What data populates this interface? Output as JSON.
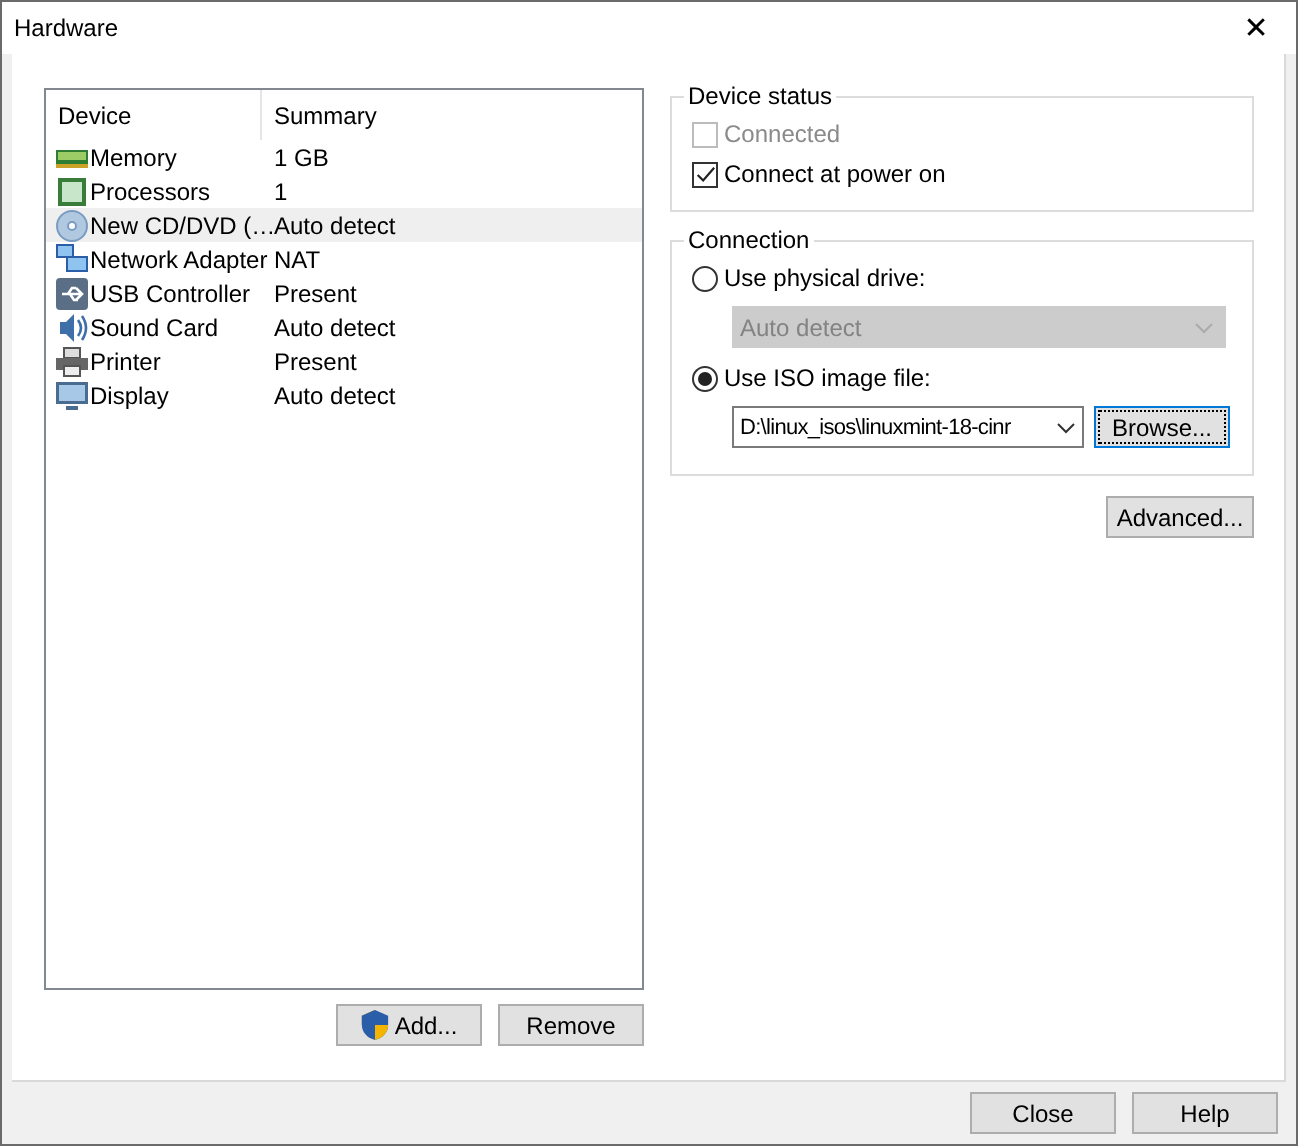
{
  "window": {
    "title": "Hardware",
    "close": "✕"
  },
  "device_list": {
    "columns": [
      "Device",
      "Summary"
    ],
    "rows": [
      {
        "kind": "memory",
        "device": "Memory",
        "summary": "1 GB",
        "selected": false
      },
      {
        "kind": "processor",
        "device": "Processors",
        "summary": "1",
        "selected": false
      },
      {
        "kind": "disc",
        "device": "New CD/DVD (…",
        "summary": "Auto detect",
        "selected": true
      },
      {
        "kind": "network",
        "device": "Network Adapter",
        "summary": "NAT",
        "selected": false
      },
      {
        "kind": "usb",
        "device": "USB Controller",
        "summary": "Present",
        "selected": false
      },
      {
        "kind": "sound",
        "device": "Sound Card",
        "summary": "Auto detect",
        "selected": false
      },
      {
        "kind": "printer",
        "device": "Printer",
        "summary": "Present",
        "selected": false
      },
      {
        "kind": "display",
        "device": "Display",
        "summary": "Auto detect",
        "selected": false
      }
    ]
  },
  "list_buttons": [
    "Add...",
    "Remove"
  ],
  "device_status": {
    "title": "Device status",
    "checkboxes": [
      {
        "label": "Connected",
        "checked": false,
        "disabled": true
      },
      {
        "label": "Connect at power on",
        "checked": true,
        "disabled": false
      }
    ]
  },
  "connection": {
    "title": "Connection",
    "options": [
      {
        "label": "Use physical drive:",
        "selected": false,
        "field": {
          "value": "Auto detect",
          "disabled": true
        }
      },
      {
        "label": "Use ISO image file:",
        "selected": true,
        "field": {
          "value": "D:\\linux_isos\\linuxmint-18-cinr",
          "disabled": false
        },
        "button": "Browse..."
      }
    ]
  },
  "advanced_button": "Advanced...",
  "footer_buttons": [
    "Close",
    "Help"
  ]
}
